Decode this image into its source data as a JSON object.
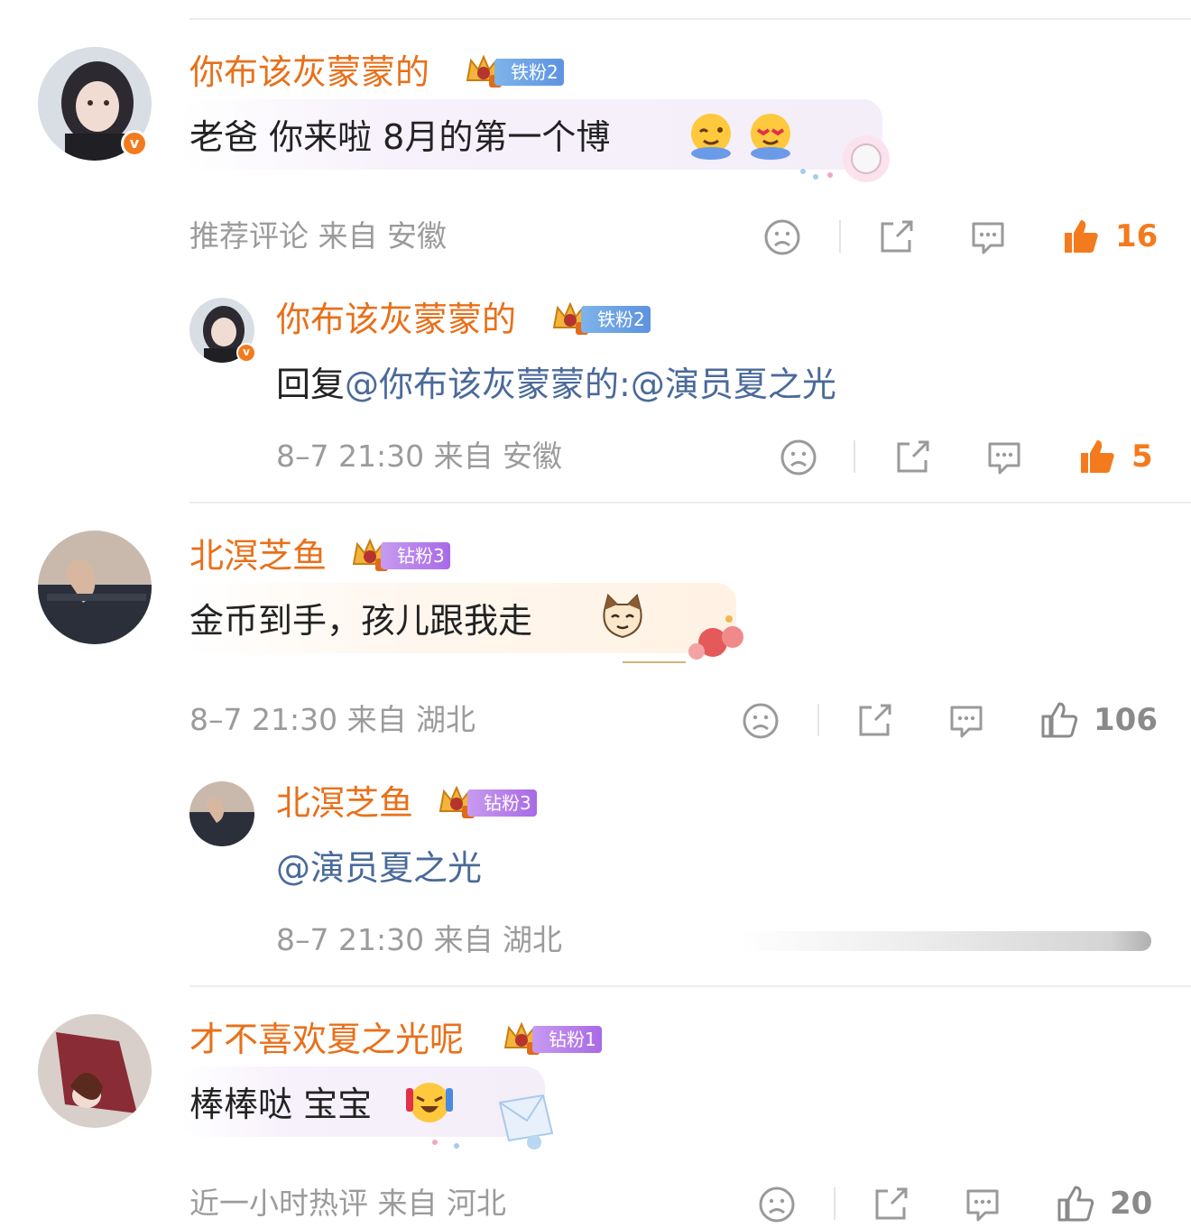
{
  "comments": [
    {
      "author": "你布该灰蒙蒙的",
      "fan_level": "铁粉2",
      "text": "老爸 你来啦 8月的第一个博",
      "meta": "推荐评论  来自 安徽",
      "likes": "16",
      "liked": true,
      "reply": {
        "author": "你布该灰蒙蒙的",
        "fan_level": "铁粉2",
        "prefix": "回复",
        "mention": "@你布该灰蒙蒙的:@演员夏之光",
        "meta": "8–7 21:30  来自 安徽",
        "likes": "5",
        "liked": true
      }
    },
    {
      "author": "北溟芝鱼",
      "fan_level": "钻粉3",
      "text": "金币到手，孩儿跟我走",
      "meta": "8–7 21:30  来自 湖北",
      "likes": "106",
      "liked": false,
      "reply": {
        "author": "北溟芝鱼",
        "fan_level": "钻粉3",
        "mention": "@演员夏之光",
        "meta": "8–7 21:30  来自 湖北"
      }
    },
    {
      "author": "才不喜欢夏之光呢",
      "fan_level": "钻粉1",
      "text": "棒棒哒 宝宝",
      "meta": "近一小时热评  来自 河北",
      "likes": "20",
      "liked": false
    }
  ],
  "colors": {
    "accent": "#e8701a",
    "like_active": "#f47b1d",
    "mention": "#4a6a9a",
    "meta": "#9b9b9b"
  },
  "icons": [
    "dislike-icon",
    "share-icon",
    "comment-icon",
    "like-icon",
    "verified-icon",
    "fan-crown-icon"
  ]
}
